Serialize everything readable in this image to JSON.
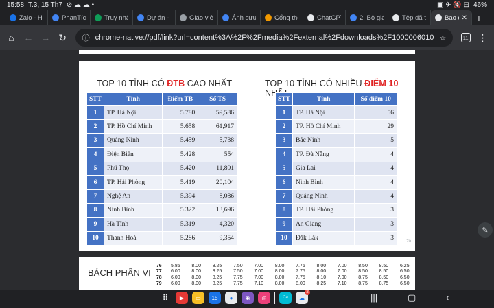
{
  "status": {
    "time": "15:58",
    "date": "T.3, 15 Th7",
    "battery": "46%"
  },
  "tabs": [
    {
      "label": "Zalo - Họ",
      "color": "#1a73e8",
      "icon": "zalo-icon"
    },
    {
      "label": "PhanTích",
      "color": "#4285f4",
      "icon": "drive-icon"
    },
    {
      "label": "Truy nhập",
      "color": "#0f9d58",
      "icon": "sheets-icon"
    },
    {
      "label": "Dự án - C",
      "color": "#4285f4",
      "icon": "app-icon"
    },
    {
      "label": "Giáo viên",
      "color": "#9aa0a6",
      "icon": "globe-icon"
    },
    {
      "label": "Ảnh sưu",
      "color": "#4285f4",
      "icon": "drive-icon"
    },
    {
      "label": "Cổng thô",
      "color": "#f29900",
      "icon": "portal-icon"
    },
    {
      "label": "ChatGPT",
      "color": "#e8eaed",
      "icon": "chatgpt-icon"
    },
    {
      "label": "2. Bộ giá",
      "color": "#4285f4",
      "icon": "drive-icon"
    },
    {
      "label": "Tệp đã tả",
      "color": "#e8eaed",
      "icon": "download-icon"
    },
    {
      "label": "Bao c",
      "color": "#e8eaed",
      "icon": "pdf-icon",
      "active": true
    }
  ],
  "toolbar": {
    "url": "chrome-native://pdf/link?url=content%3A%2F%2Fmedia%2Fexternal%2Fdownloads%2F1000006010",
    "tab_count": "11"
  },
  "left_table": {
    "title_pre": "TOP 10 TỈNH CÓ ",
    "title_red": "ĐTB",
    "title_post": " CAO NHẤT",
    "headers": [
      "STT",
      "Tỉnh",
      "Điểm TB",
      "Số TS"
    ],
    "rows": [
      [
        "1",
        "TP. Hà Nội",
        "5.780",
        "59,586"
      ],
      [
        "2",
        "TP. Hồ Chí Minh",
        "5.658",
        "61,917"
      ],
      [
        "3",
        "Quảng Ninh",
        "5.459",
        "5,738"
      ],
      [
        "4",
        "Điện Biên",
        "5.428",
        "554"
      ],
      [
        "5",
        "Phú Thọ",
        "5.420",
        "11,801"
      ],
      [
        "6",
        "TP. Hải Phòng",
        "5.419",
        "20,104"
      ],
      [
        "7",
        "Nghệ An",
        "5.394",
        "8,086"
      ],
      [
        "8",
        "Ninh Bình",
        "5.322",
        "13,696"
      ],
      [
        "9",
        "Hà Tĩnh",
        "5.319",
        "4,320"
      ],
      [
        "10",
        "Thanh Hoá",
        "5.286",
        "9,354"
      ]
    ]
  },
  "right_table": {
    "title_pre": "TOP 10 TỈNH CÓ NHIỀU ",
    "title_red": "ĐIỂM 10",
    "title_post": " NHẤT",
    "headers": [
      "STT",
      "Tỉnh",
      "Số điểm 10"
    ],
    "rows": [
      [
        "1",
        "TP. Hà Nội",
        "56"
      ],
      [
        "2",
        "TP. Hồ Chí Minh",
        "29"
      ],
      [
        "3",
        "Bắc Ninh",
        "5"
      ],
      [
        "4",
        "TP. Đà Nẵng",
        "4"
      ],
      [
        "5",
        "Gia Lai",
        "4"
      ],
      [
        "6",
        "Ninh Bình",
        "4"
      ],
      [
        "7",
        "Quảng Ninh",
        "4"
      ],
      [
        "8",
        "TP. Hải Phòng",
        "3"
      ],
      [
        "9",
        "An Giang",
        "3"
      ],
      [
        "10",
        "Đắk Lắk",
        "3"
      ]
    ]
  },
  "page_number": "70",
  "next_page": {
    "title": "BÁCH PHÂN VỊ",
    "rows": [
      [
        "76",
        "5.85",
        "8.00",
        "8.25",
        "7.50",
        "7.00",
        "8.00",
        "7.75",
        "8.00",
        "7.00",
        "8.50",
        "8.50",
        "6.25"
      ],
      [
        "77",
        "6.00",
        "8.00",
        "8.25",
        "7.50",
        "7.00",
        "8.00",
        "7.75",
        "8.00",
        "7.00",
        "8.50",
        "8.50",
        "6.50"
      ],
      [
        "78",
        "6.00",
        "8.00",
        "8.25",
        "7.75",
        "7.00",
        "8.00",
        "7.75",
        "8.10",
        "7.00",
        "8.75",
        "8.50",
        "6.50"
      ],
      [
        "79",
        "6.00",
        "8.00",
        "8.25",
        "7.75",
        "7.10",
        "8.00",
        "8.00",
        "8.25",
        "7.10",
        "8.75",
        "8.75",
        "6.50"
      ]
    ]
  },
  "dock": {
    "calendar_day": "15",
    "cloud_badge": "2"
  }
}
